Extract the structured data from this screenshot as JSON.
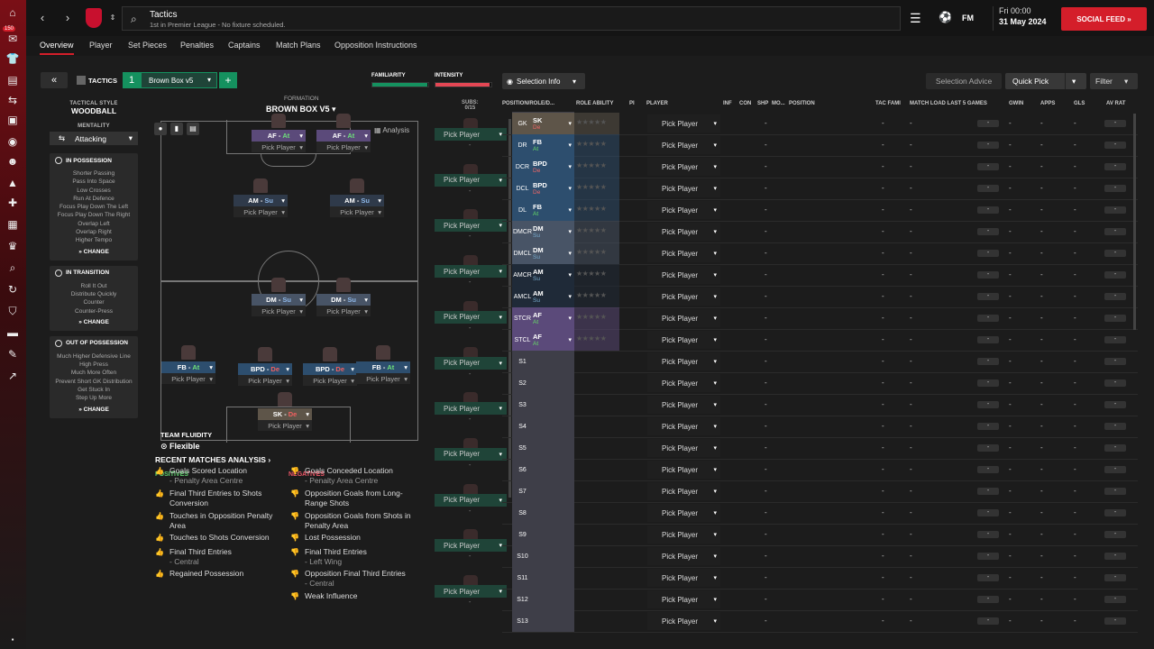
{
  "topbar": {
    "title": "Tactics",
    "subtitle": "1st in Premier League - No fixture scheduled.",
    "fm": "FM",
    "day": "Fri 00:00",
    "date": "31 May 2024",
    "social": "SOCIAL FEED",
    "badge": "150"
  },
  "tabs": [
    "Overview",
    "Player",
    "Set Pieces",
    "Penalties",
    "Captains",
    "Match Plans",
    "Opposition Instructions"
  ],
  "tactic": {
    "label": "TACTICS",
    "slot": "1",
    "name": "Brown Box v5",
    "familiarity_label": "FAMILIARITY",
    "familiarity": 0.98,
    "intensity_label": "INTENSITY",
    "intensity": 0.97,
    "style_label": "TACTICAL STYLE",
    "style": "WOODBALL",
    "mentality_label": "MENTALITY",
    "mentality": "Attacking",
    "formation_label": "FORMATION",
    "formation": "BROWN BOX V5",
    "analysis": "Analysis",
    "subs_label": "SUBS:",
    "subs_count": "0/15",
    "fluidity_label": "TEAM FLUIDITY",
    "fluidity": "Flexible"
  },
  "in_possession": {
    "title": "IN POSSESSION",
    "items": [
      "Shorter Passing",
      "Pass Into Space",
      "Low Crosses",
      "Run At Defence",
      "Focus Play Down The Left",
      "Focus Play Down The Right",
      "Overlap Left",
      "Overlap Right",
      "Higher Tempo"
    ],
    "change": "CHANGE"
  },
  "in_transition": {
    "title": "IN TRANSITION",
    "items": [
      "Roll It Out",
      "Distribute Quickly",
      "Counter",
      "Counter-Press"
    ],
    "change": "CHANGE"
  },
  "out_of_possession": {
    "title": "OUT OF POSSESSION",
    "items": [
      "Much Higher Defensive Line",
      "High Press",
      "Much More Often",
      "Prevent Short GK Distribution",
      "Get Stuck In",
      "Step Up More"
    ],
    "change": "CHANGE"
  },
  "pitch_players": [
    {
      "role": "AF",
      "duty": "At",
      "color": "#5b4a7a",
      "pick": "Pick Player"
    },
    {
      "role": "AF",
      "duty": "At",
      "color": "#5b4a7a",
      "pick": "Pick Player"
    },
    {
      "role": "AM",
      "duty": "Su",
      "color": "#2f3a4a",
      "pick": "Pick Player"
    },
    {
      "role": "AM",
      "duty": "Su",
      "color": "#2f3a4a",
      "pick": "Pick Player"
    },
    {
      "role": "DM",
      "duty": "Su",
      "color": "#485466",
      "pick": "Pick Player"
    },
    {
      "role": "DM",
      "duty": "Su",
      "color": "#485466",
      "pick": "Pick Player"
    },
    {
      "role": "FB",
      "duty": "At",
      "color": "#2d4e6e",
      "pick": "Pick Player"
    },
    {
      "role": "BPD",
      "duty": "De",
      "color": "#2d4e6e",
      "pick": "Pick Player"
    },
    {
      "role": "BPD",
      "duty": "De",
      "color": "#2d4e6e",
      "pick": "Pick Player"
    },
    {
      "role": "FB",
      "duty": "At",
      "color": "#2d4e6e",
      "pick": "Pick Player"
    },
    {
      "role": "SK",
      "duty": "De",
      "color": "#5e5549",
      "pick": "Pick Player"
    }
  ],
  "subs_pick": "Pick Player",
  "subs_dash": "-",
  "recent": {
    "title": "RECENT MATCHES ANALYSIS",
    "positives_label": "POSITIVES",
    "negatives_label": "NEGATIVES",
    "positives": [
      {
        "t": "Goals Scored Location",
        "s": "- Penalty Area Centre"
      },
      {
        "t": "Final Third Entries to Shots Conversion",
        "s": ""
      },
      {
        "t": "Touches in Opposition Penalty Area",
        "s": ""
      },
      {
        "t": "Touches to Shots Conversion",
        "s": ""
      },
      {
        "t": "Final Third Entries",
        "s": "- Central"
      },
      {
        "t": "Regained Possession",
        "s": ""
      }
    ],
    "negatives": [
      {
        "t": "Goals Conceded Location",
        "s": "- Penalty Area Centre",
        "c": "#d23a3a"
      },
      {
        "t": "Opposition Goals from Long-Range Shots",
        "s": "",
        "c": "#d23a3a"
      },
      {
        "t": "Opposition Goals from Shots in Penalty Area",
        "s": "",
        "c": "#e06a2a"
      },
      {
        "t": "Lost Possession",
        "s": "",
        "c": "#e06a2a"
      },
      {
        "t": "Final Third Entries",
        "s": "- Left Wing",
        "c": "#e06a2a"
      },
      {
        "t": "Opposition Final Third Entries",
        "s": "- Central",
        "c": "#e06a2a"
      },
      {
        "t": "Weak Influence",
        "s": "",
        "c": "#e06a2a"
      }
    ]
  },
  "right": {
    "selection_info": "Selection Info",
    "selection_advice": "Selection Advice",
    "quick_pick": "Quick Pick",
    "filter": "Filter",
    "headers": [
      "POSITION/ROLE/D...",
      "ROLE ABILITY",
      "PI",
      "PLAYER",
      "INF",
      "CON",
      "SHP",
      "MO...",
      "POSITION",
      "TAC FAMI",
      "MATCH LOAD LAST 5 GAMES",
      "GWIN",
      "APPS",
      "GLS",
      "AV RAT"
    ],
    "rows": [
      {
        "code": "GK",
        "role": "SK",
        "duty": "De",
        "dcol": "#e66",
        "bg": "#5e5549"
      },
      {
        "code": "DR",
        "role": "FB",
        "duty": "At",
        "dcol": "#6d6",
        "bg": "#2d4e6e"
      },
      {
        "code": "DCR",
        "role": "BPD",
        "duty": "De",
        "dcol": "#e66",
        "bg": "#2d4e6e"
      },
      {
        "code": "DCL",
        "role": "BPD",
        "duty": "De",
        "dcol": "#e66",
        "bg": "#2d4e6e"
      },
      {
        "code": "DL",
        "role": "FB",
        "duty": "At",
        "dcol": "#6d6",
        "bg": "#2d4e6e"
      },
      {
        "code": "DMCR",
        "role": "DM",
        "duty": "Su",
        "dcol": "#7ac",
        "bg": "#485466"
      },
      {
        "code": "DMCL",
        "role": "DM",
        "duty": "Su",
        "dcol": "#7ac",
        "bg": "#485466"
      },
      {
        "code": "AMCR",
        "role": "AM",
        "duty": "Su",
        "dcol": "#7ac",
        "bg": "#1f2a38"
      },
      {
        "code": "AMCL",
        "role": "AM",
        "duty": "Su",
        "dcol": "#7ac",
        "bg": "#1f2a38"
      },
      {
        "code": "STCR",
        "role": "AF",
        "duty": "At",
        "dcol": "#6d6",
        "bg": "#5b4a7a"
      },
      {
        "code": "STCL",
        "role": "AF",
        "duty": "At",
        "dcol": "#6d6",
        "bg": "#5b4a7a"
      },
      {
        "code": "S1",
        "role": "",
        "duty": "",
        "dcol": "",
        "bg": "#3e3e48"
      },
      {
        "code": "S2",
        "role": "",
        "duty": "",
        "dcol": "",
        "bg": "#3e3e48"
      },
      {
        "code": "S3",
        "role": "",
        "duty": "",
        "dcol": "",
        "bg": "#3e3e48"
      },
      {
        "code": "S4",
        "role": "",
        "duty": "",
        "dcol": "",
        "bg": "#3e3e48"
      },
      {
        "code": "S5",
        "role": "",
        "duty": "",
        "dcol": "",
        "bg": "#3e3e48"
      },
      {
        "code": "S6",
        "role": "",
        "duty": "",
        "dcol": "",
        "bg": "#3e3e48"
      },
      {
        "code": "S7",
        "role": "",
        "duty": "",
        "dcol": "",
        "bg": "#3e3e48"
      },
      {
        "code": "S8",
        "role": "",
        "duty": "",
        "dcol": "",
        "bg": "#3e3e48"
      },
      {
        "code": "S9",
        "role": "",
        "duty": "",
        "dcol": "",
        "bg": "#3e3e48"
      },
      {
        "code": "S10",
        "role": "",
        "duty": "",
        "dcol": "",
        "bg": "#3e3e48"
      },
      {
        "code": "S11",
        "role": "",
        "duty": "",
        "dcol": "",
        "bg": "#3e3e48"
      },
      {
        "code": "S12",
        "role": "",
        "duty": "",
        "dcol": "",
        "bg": "#3e3e48"
      },
      {
        "code": "S13",
        "role": "",
        "duty": "",
        "dcol": "",
        "bg": "#3e3e48"
      }
    ],
    "pick": "Pick Player",
    "dash": "-"
  }
}
